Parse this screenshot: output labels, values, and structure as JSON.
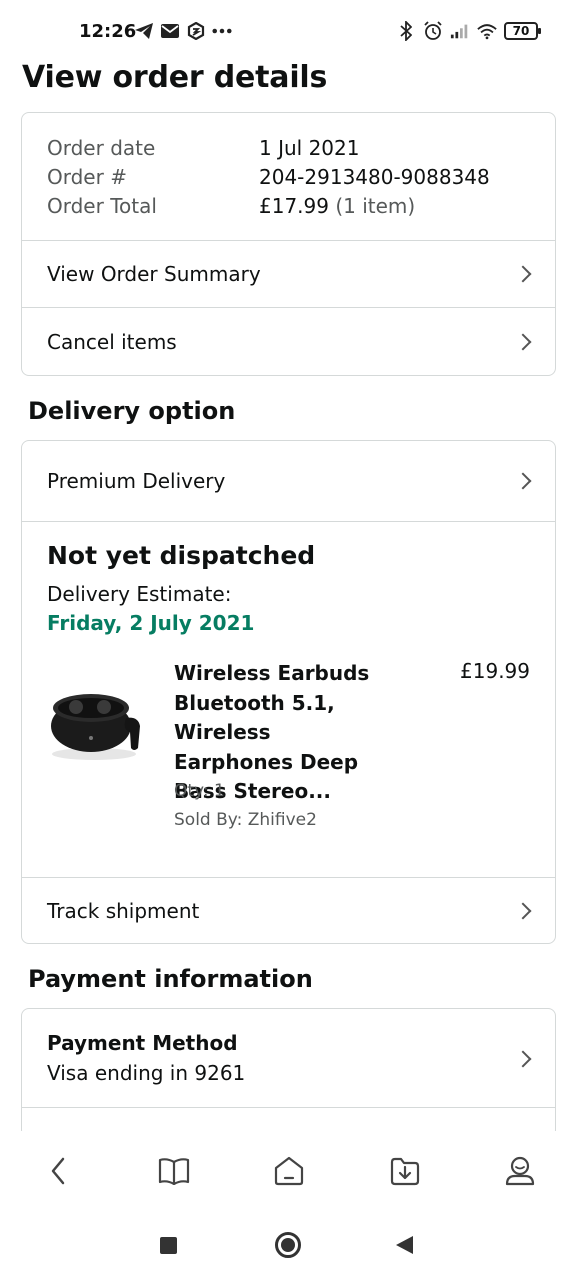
{
  "status_bar": {
    "time": "12:26",
    "left_icons": [
      "telegram-icon",
      "mail-icon",
      "app-icon",
      "more-icon"
    ],
    "right_icons": [
      "bluetooth-icon",
      "alarm-icon",
      "signal-icon",
      "wifi-icon"
    ],
    "battery": "70"
  },
  "page_title": "View order details",
  "order": {
    "date_label": "Order date",
    "date_value": "1 Jul 2021",
    "number_label": "Order #",
    "number_value": "204-2913480-9088348",
    "total_label": "Order Total",
    "total_value": "£17.99",
    "total_items": "(1 item)",
    "summary_link": "View Order Summary",
    "cancel_link": "Cancel items"
  },
  "delivery": {
    "section_title": "Delivery option",
    "option_label": "Premium Delivery",
    "status": "Not yet dispatched",
    "estimate_label": "Delivery Estimate:",
    "estimate_date": "Friday, 2 July 2021",
    "estimate_color": "#067d62",
    "product": {
      "title": "Wireless Earbuds Bluetooth 5.1, Wireless Earphones Deep Bass Stereo...",
      "price": "£19.99",
      "qty": "Qty: 1",
      "seller": "Sold By: Zhifive2"
    },
    "track_link": "Track shipment"
  },
  "payment": {
    "section_title": "Payment information",
    "method_title": "Payment Method",
    "method_value": "Visa ending in 9261"
  },
  "bottom_nav": [
    "back-icon",
    "book-icon",
    "home-icon",
    "download-icon",
    "profile-icon"
  ]
}
